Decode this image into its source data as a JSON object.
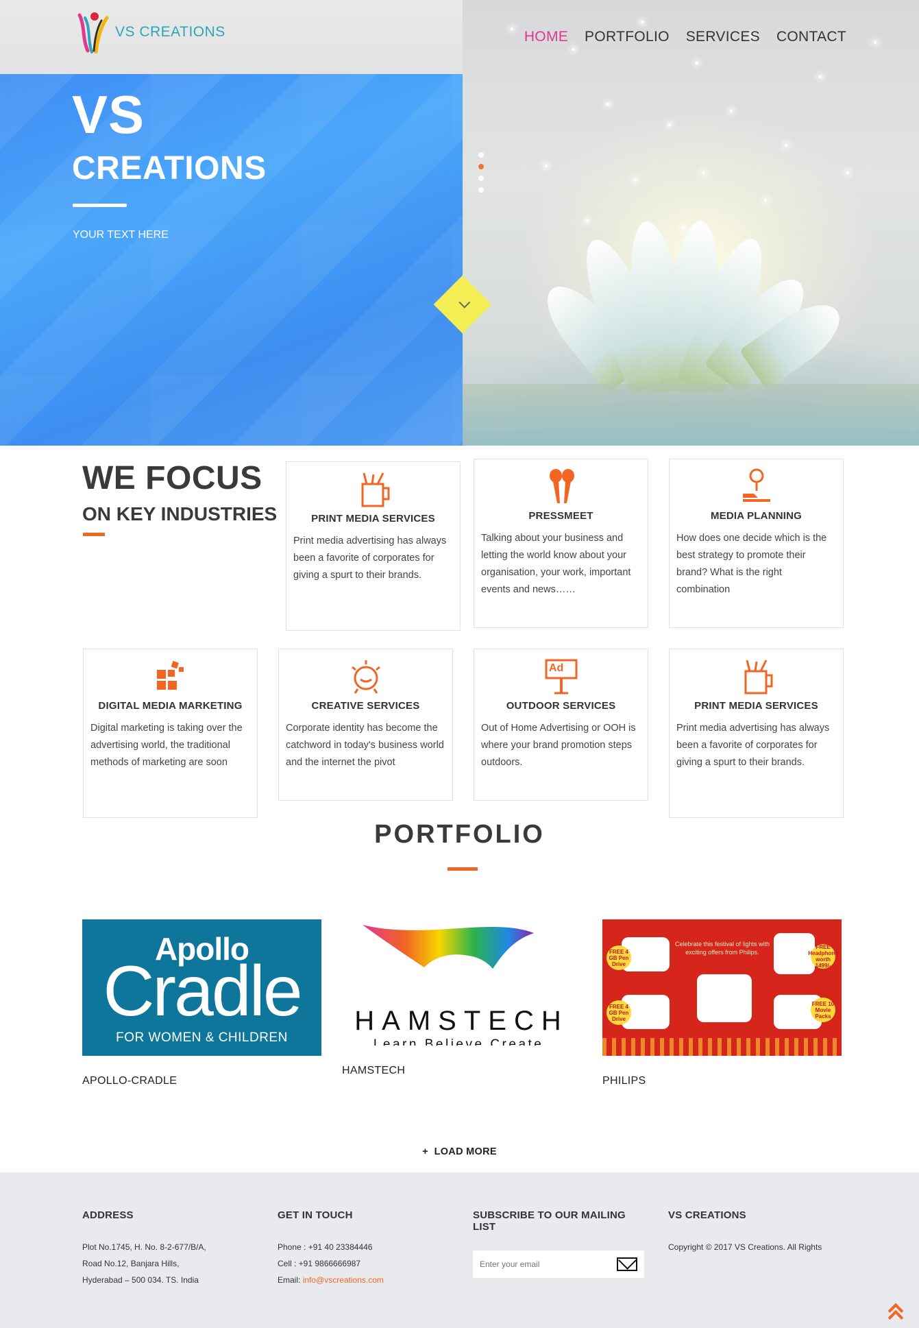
{
  "brand": {
    "name": "VS CREATIONS"
  },
  "nav": {
    "items": [
      {
        "label": "HOME",
        "active": true
      },
      {
        "label": "PORTFOLIO",
        "active": false
      },
      {
        "label": "SERVICES",
        "active": false
      },
      {
        "label": "CONTACT",
        "active": false
      }
    ]
  },
  "hero": {
    "title_line1": "VS",
    "title_line2": "CREATIONS",
    "subtitle": "YOUR TEXT HERE",
    "slide_count": 4,
    "active_slide": 2,
    "scroll_icon": "chevron-down-icon"
  },
  "focus": {
    "title_line1": "WE FOCUS",
    "title_line2": "ON KEY INDUSTRIES",
    "cards": [
      {
        "icon": "pen-holder-icon",
        "title": "PRINT MEDIA SERVICES",
        "text": "Print media advertising has always been a favorite of corporates for giving a spurt to their brands."
      },
      {
        "icon": "microphones-icon",
        "title": "PRESSMEET",
        "text": "Talking about your business and letting the world know about your organisation, your work, important events and news……"
      },
      {
        "icon": "idea-hand-icon",
        "title": "MEDIA PLANNING",
        "text": "How does one decide which is the best strategy to promote their brand? What is the right combination"
      },
      {
        "icon": "squares-icon",
        "title": "DIGITAL MEDIA MARKETING",
        "text": "Digital marketing is taking over the advertising world, the traditional methods of marketing are soon"
      },
      {
        "icon": "alarm-clock-icon",
        "title": "CREATIVE SERVICES",
        "text": "Corporate identity has become the catchword in today's business world and the internet the pivot"
      },
      {
        "icon": "billboard-icon",
        "title": "OUTDOOR SERVICES",
        "text": "Out of Home Advertising or OOH is where your brand promotion steps outdoors."
      },
      {
        "icon": "pen-holder-icon",
        "title": "PRINT MEDIA SERVICES",
        "text": "Print media advertising has always been a favorite of corporates for giving a spurt to their brands."
      }
    ]
  },
  "portfolio": {
    "title": "PORTFOLIO",
    "items": [
      {
        "caption": "APOLLO-CRADLE",
        "logo_line1": "Apollo",
        "logo_line2": "Cradle",
        "logo_line3": "FOR WOMEN & CHILDREN"
      },
      {
        "caption": "HAMSTECH",
        "logo_word": "HAMSTECH",
        "logo_tag": "Learn.Believe.Create."
      },
      {
        "caption": "PHILIPS",
        "banner_text": "Celebrate this festival of lights with exciting offers from Philips.",
        "badges": [
          "FREE 4 GB Pen Drive",
          "FREE Headphone worth 1499/-",
          "FREE 4 GB Pen Drive",
          "FREE 10 Movie Packs"
        ]
      }
    ],
    "load_more": "LOAD MORE"
  },
  "footer": {
    "address": {
      "heading": "ADDRESS",
      "line1": "Plot No.1745, H. No. 8-2-677/B/A,",
      "line2": "Road No.12, Banjara Hills,",
      "line3": "Hyderabad – 500 034. TS. India"
    },
    "contact": {
      "heading": "GET IN TOUCH",
      "phone": "Phone : +91 40 23384446",
      "cell": "Cell : +91 9866666987",
      "email_label": "Email: ",
      "email": "info@vscreations.com"
    },
    "subscribe": {
      "heading": "SUBSCRIBE TO OUR MAILING LIST",
      "placeholder": "Enter your email"
    },
    "about": {
      "heading": "VS CREATIONS",
      "copyright": "Copyright © 2017 VS Creations. All Rights"
    }
  },
  "colors": {
    "accent": "#f26522",
    "nav_active": "#e0388f",
    "hero_blue": "#4aa7fb",
    "brand_teal": "#2ba6b8",
    "scroll_button": "#f4ee55"
  }
}
